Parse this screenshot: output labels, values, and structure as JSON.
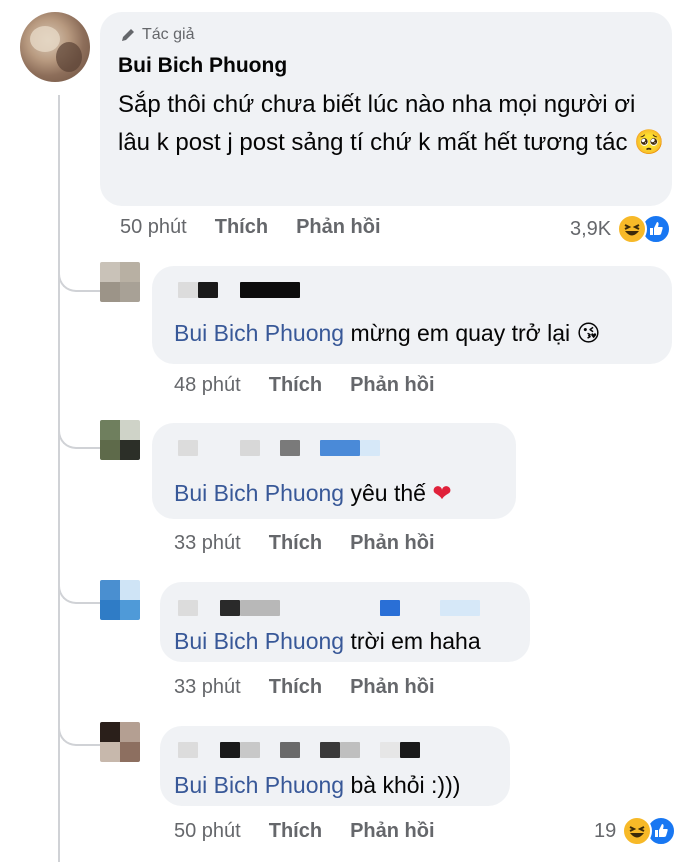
{
  "main_comment": {
    "author_badge": "Tác giả",
    "author": "Bui Bich Phuong",
    "text": "Sắp thôi chứ chưa biết lúc nào nha mọi người ơi lâu k post j post sảng tí chứ k mất hết tương tác",
    "emoji": "🥺",
    "time": "50 phút",
    "like_label": "Thích",
    "reply_label": "Phản hồi",
    "reaction_count": "3,9K"
  },
  "replies": [
    {
      "mention": "Bui Bich Phuong",
      "text": "mừng em quay trở lại",
      "emoji": "😘",
      "time": "48 phút",
      "like_label": "Thích",
      "reply_label": "Phản hồi"
    },
    {
      "mention": "Bui Bich Phuong",
      "text": "yêu thế",
      "emoji": "❤️",
      "time": "33 phút",
      "like_label": "Thích",
      "reply_label": "Phản hồi"
    },
    {
      "mention": "Bui Bich Phuong",
      "text": "trời em haha",
      "time": "33 phút",
      "like_label": "Thích",
      "reply_label": "Phản hồi"
    },
    {
      "mention": "Bui Bich Phuong",
      "text": "bà khỏi :)))",
      "time": "50 phút",
      "like_label": "Thích",
      "reply_label": "Phản hồi",
      "reaction_count": "19"
    }
  ],
  "icons": [
    "pencil-icon",
    "haha-reaction-icon",
    "like-reaction-icon"
  ],
  "colors": {
    "mention": "#385898",
    "bubble": "#f0f2f5",
    "meta": "#65676b",
    "like_blue": "#1877f2",
    "haha_yellow": "#f7b928"
  }
}
